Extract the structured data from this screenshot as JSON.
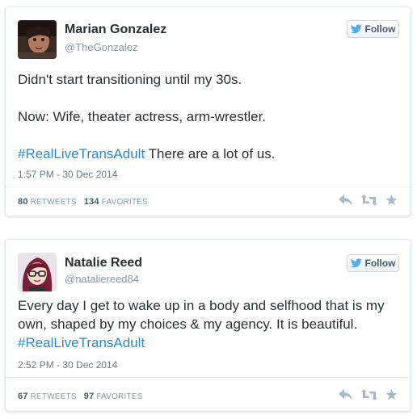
{
  "tweets": [
    {
      "name": "Marian Gonzalez",
      "handle": "@TheGonzalez",
      "follow_label": "Follow",
      "text_line1": "Didn't start transitioning until my 30s.",
      "text_line2": "Now: Wife, theater actress, arm-wrestler.",
      "hashtag": "#RealLiveTransAdult",
      "text_after_hashtag": " There are a lot of us.",
      "timestamp": "1:57 PM - 30 Dec 2014",
      "retweets_count": "80",
      "retweets_label": "RETWEETS",
      "favorites_count": "134",
      "favorites_label": "FAVORITES"
    },
    {
      "name": "Natalie Reed",
      "handle": "@nataliereed84",
      "follow_label": "Follow",
      "text_main": "Every day I get to wake up in a body and selfhood that is my own, shaped by my choices & my agency. It is beautiful. ",
      "hashtag": "#RealLiveTransAdult",
      "timestamp": "2:52 PM - 30 Dec 2014",
      "retweets_count": "67",
      "retweets_label": "RETWEETS",
      "favorites_count": "97",
      "favorites_label": "FAVORITES"
    }
  ],
  "icons": {
    "follow": "twitter-bird-icon",
    "reply": "reply-icon",
    "retweet": "retweet-icon",
    "favorite": "star-icon"
  },
  "colors": {
    "hashtag": "#2b8ad1",
    "twitter_blue": "#55acee",
    "action_icons": "#aab8c2"
  }
}
